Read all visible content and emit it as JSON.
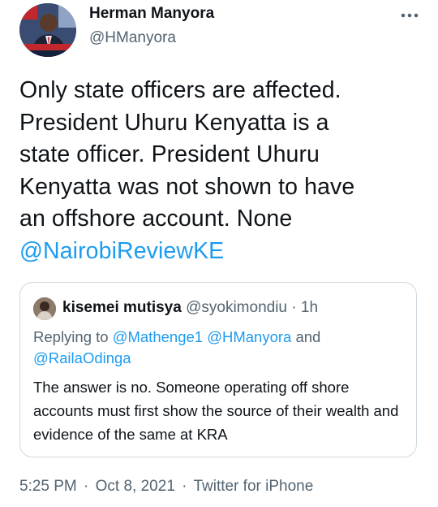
{
  "tweet": {
    "author_name": "Herman Manyora",
    "author_handle": "@HManyora",
    "avatar_icon": "profile-photo",
    "more_icon": "more-horizontal-icon",
    "text_lines": [
      "Only state officers are affected.",
      "President Uhuru Kenyatta is a",
      "state officer. President Uhuru",
      "Kenyatta was not shown to have",
      "an offshore account. None"
    ],
    "mention": "@NairobiReviewKE"
  },
  "quote": {
    "author_name": "kisemei mutisya",
    "author_handle": "@syokimondiu",
    "separator": "·",
    "time": "1h",
    "replying_prefix": "Replying to",
    "replying_to_1": "@Mathenge1",
    "replying_to_2": "@HManyora",
    "replying_and": "and",
    "replying_to_3": "@RailaOdinga",
    "text": "The answer is no. Someone operating off shore accounts must first show the source of their wealth and evidence of the same at KRA"
  },
  "footer": {
    "time": "5:25 PM",
    "date": "Oct 8, 2021",
    "source": "Twitter for iPhone",
    "separator": "·"
  },
  "colors": {
    "text": "#0f1419",
    "secondary": "#536471",
    "accent": "#1d9bf0",
    "border": "#cfd9de"
  }
}
